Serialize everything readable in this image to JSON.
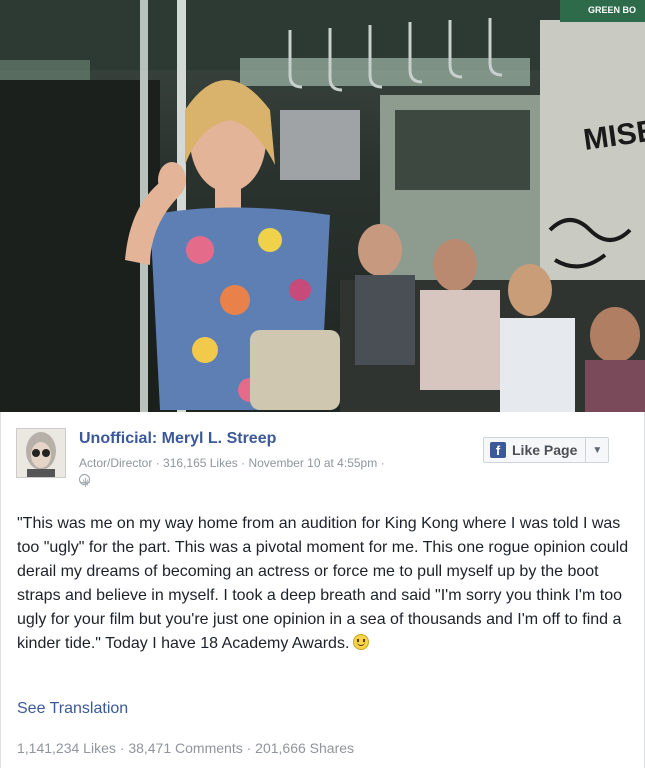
{
  "post": {
    "page_name": "Unofficial: Meryl L. Streep",
    "category": "Actor/Director",
    "likes": "316,165 Likes",
    "date": "November 10 at 4:55pm",
    "like_page_label": "Like Page",
    "text": "\"This was me on my way home from an audition for King Kong where I was told I was too \"ugly\" for the part. This was a pivotal moment for me. This one rogue opinion could derail my dreams of becoming an actress or force me to pull myself up by the boot straps and believe in myself. I took a deep breath and said \"I'm sorry you think I'm too ugly for your film but you're just one opinion in a sea of thousands and I'm off to find a kinder tide.\" Today I have 18 Academy Awards.",
    "see_translation": "See Translation",
    "stats": {
      "likes": "1,141,234 Likes",
      "comments": "38,471 Comments",
      "shares": "201,666 Shares"
    }
  },
  "photo": {
    "sign_text": "GREEN BO",
    "graffiti": "MISE"
  },
  "colors": {
    "link_blue": "#3b5998",
    "meta_gray": "#90949c",
    "facebook_blue": "#3b5998"
  },
  "icons": [
    "facebook-logo-icon",
    "chevron-down-icon",
    "globe-icon",
    "smiley-emoji-icon"
  ]
}
